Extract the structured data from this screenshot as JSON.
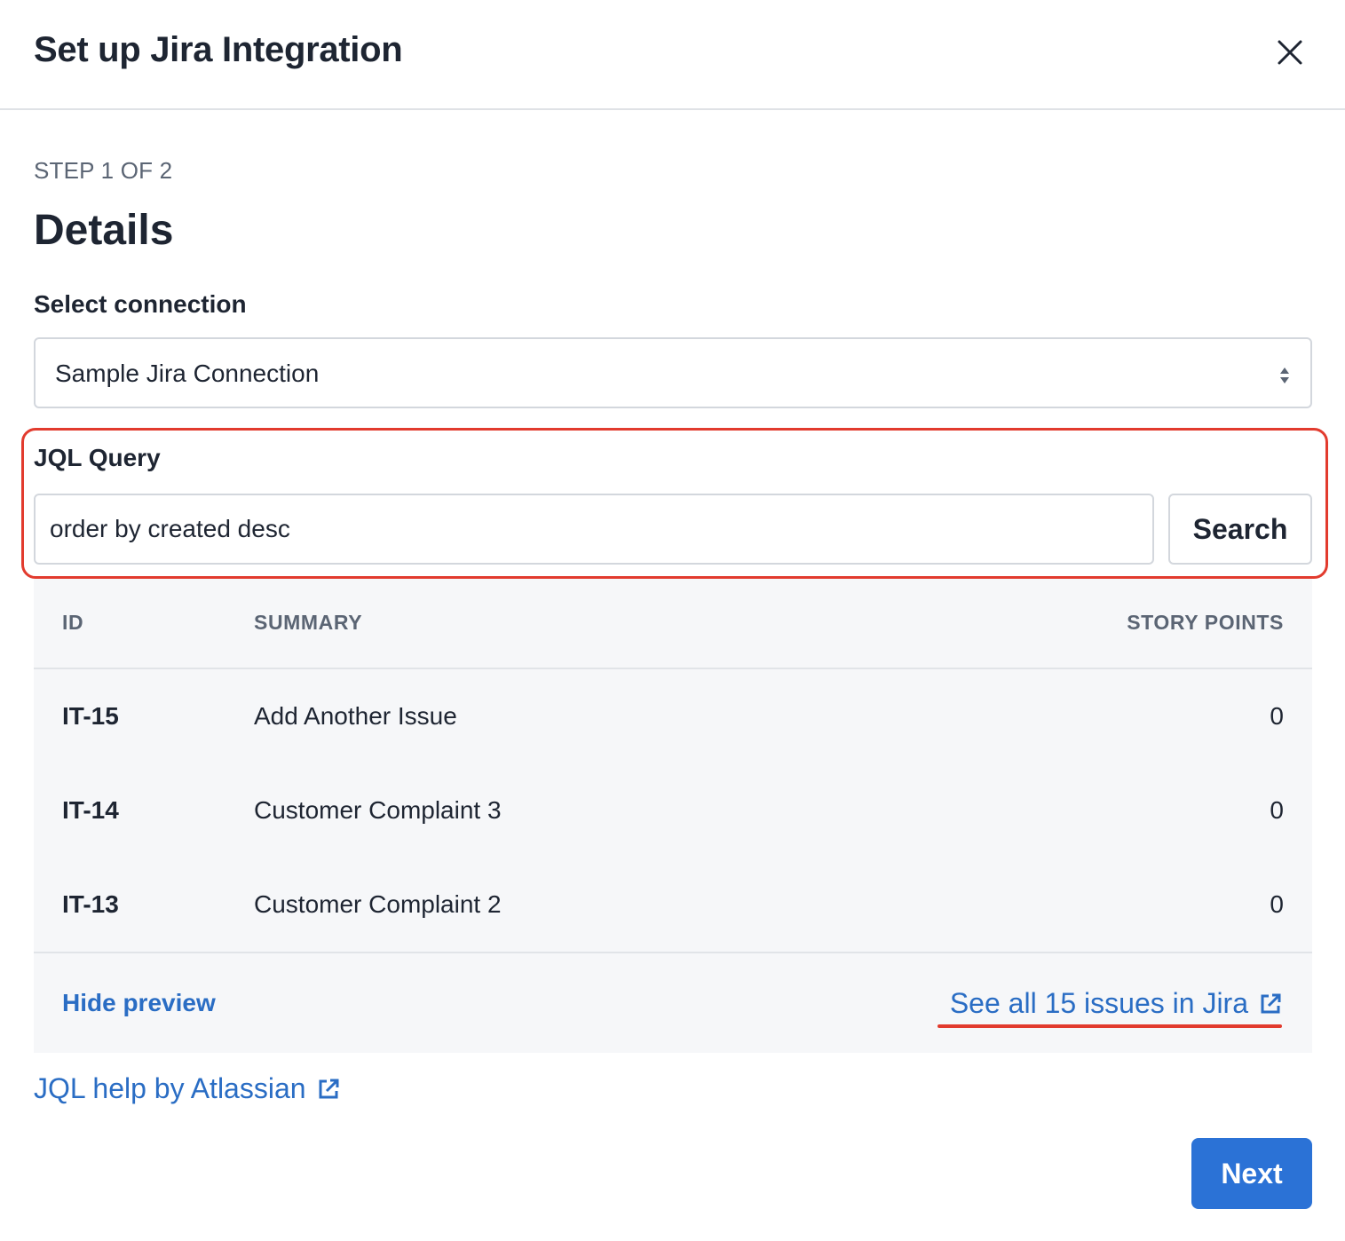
{
  "modal": {
    "title": "Set up Jira Integration",
    "close_icon": "close-icon"
  },
  "step": {
    "label": "STEP 1 OF 2",
    "heading": "Details"
  },
  "connection": {
    "label": "Select connection",
    "selected": "Sample Jira Connection",
    "caret_icon": "select-caret-icon"
  },
  "jql": {
    "label": "JQL Query",
    "value": "order by created desc",
    "search_label": "Search"
  },
  "preview": {
    "columns": {
      "id": "ID",
      "summary": "SUMMARY",
      "story_points": "STORY POINTS"
    },
    "rows": [
      {
        "id": "IT-15",
        "summary": "Add Another Issue",
        "story_points": "0"
      },
      {
        "id": "IT-14",
        "summary": "Customer Complaint 3",
        "story_points": "0"
      },
      {
        "id": "IT-13",
        "summary": "Customer Complaint 2",
        "story_points": "0"
      }
    ],
    "hide_label": "Hide preview",
    "see_all_label": "See all 15 issues in Jira",
    "external_link_icon": "external-link-icon"
  },
  "help": {
    "label": "JQL help by Atlassian"
  },
  "footer": {
    "next_label": "Next"
  },
  "colors": {
    "accent": "#2b72d6",
    "link": "#2a6dc4",
    "highlight": "#e23b2e"
  }
}
